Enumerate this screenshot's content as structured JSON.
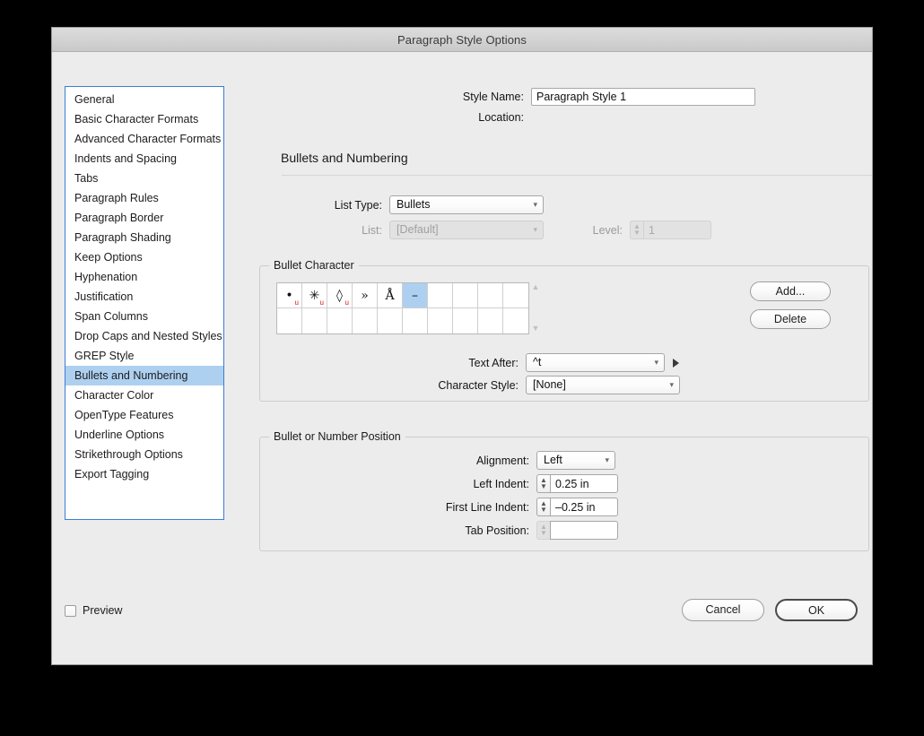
{
  "window": {
    "title": "Paragraph Style Options"
  },
  "sidebar": {
    "items": [
      {
        "label": "General",
        "selected": false
      },
      {
        "label": "Basic Character Formats",
        "selected": false
      },
      {
        "label": "Advanced Character Formats",
        "selected": false
      },
      {
        "label": "Indents and Spacing",
        "selected": false
      },
      {
        "label": "Tabs",
        "selected": false
      },
      {
        "label": "Paragraph Rules",
        "selected": false
      },
      {
        "label": "Paragraph Border",
        "selected": false
      },
      {
        "label": "Paragraph Shading",
        "selected": false
      },
      {
        "label": "Keep Options",
        "selected": false
      },
      {
        "label": "Hyphenation",
        "selected": false
      },
      {
        "label": "Justification",
        "selected": false
      },
      {
        "label": "Span Columns",
        "selected": false
      },
      {
        "label": "Drop Caps and Nested Styles",
        "selected": false
      },
      {
        "label": "GREP Style",
        "selected": false
      },
      {
        "label": "Bullets and Numbering",
        "selected": true
      },
      {
        "label": "Character Color",
        "selected": false
      },
      {
        "label": "OpenType Features",
        "selected": false
      },
      {
        "label": "Underline Options",
        "selected": false
      },
      {
        "label": "Strikethrough Options",
        "selected": false
      },
      {
        "label": "Export Tagging",
        "selected": false
      }
    ]
  },
  "header": {
    "style_name_label": "Style Name:",
    "style_name_value": "Paragraph Style 1",
    "location_label": "Location:",
    "location_value": ""
  },
  "section": {
    "title": "Bullets and Numbering"
  },
  "list_settings": {
    "list_type_label": "List Type:",
    "list_type_value": "Bullets",
    "list_label": "List:",
    "list_value": "[Default]",
    "level_label": "Level:",
    "level_value": "1"
  },
  "bullet_character": {
    "group_label": "Bullet Character",
    "cells": [
      {
        "glyph": "•",
        "unicode_marker": "u",
        "selected": false
      },
      {
        "glyph": "✳",
        "unicode_marker": "u",
        "selected": false
      },
      {
        "glyph": "◊",
        "unicode_marker": "u",
        "selected": false
      },
      {
        "glyph": "»",
        "unicode_marker": "",
        "selected": false
      },
      {
        "glyph": "Å",
        "unicode_marker": "",
        "selected": false
      },
      {
        "glyph": "–",
        "unicode_marker": "",
        "selected": true
      },
      {
        "glyph": "",
        "unicode_marker": "",
        "selected": false
      },
      {
        "glyph": "",
        "unicode_marker": "",
        "selected": false
      },
      {
        "glyph": "",
        "unicode_marker": "",
        "selected": false
      },
      {
        "glyph": "",
        "unicode_marker": "",
        "selected": false
      },
      {
        "glyph": "",
        "unicode_marker": "",
        "selected": false
      },
      {
        "glyph": "",
        "unicode_marker": "",
        "selected": false
      },
      {
        "glyph": "",
        "unicode_marker": "",
        "selected": false
      },
      {
        "glyph": "",
        "unicode_marker": "",
        "selected": false
      },
      {
        "glyph": "",
        "unicode_marker": "",
        "selected": false
      },
      {
        "glyph": "",
        "unicode_marker": "",
        "selected": false
      },
      {
        "glyph": "",
        "unicode_marker": "",
        "selected": false
      },
      {
        "glyph": "",
        "unicode_marker": "",
        "selected": false
      },
      {
        "glyph": "",
        "unicode_marker": "",
        "selected": false
      },
      {
        "glyph": "",
        "unicode_marker": "",
        "selected": false
      }
    ],
    "add_label": "Add...",
    "delete_label": "Delete",
    "text_after_label": "Text After:",
    "text_after_value": "^t",
    "character_style_label": "Character Style:",
    "character_style_value": "[None]"
  },
  "bullet_position": {
    "group_label": "Bullet or Number Position",
    "alignment_label": "Alignment:",
    "alignment_value": "Left",
    "left_indent_label": "Left Indent:",
    "left_indent_value": "0.25 in",
    "first_line_indent_label": "First Line Indent:",
    "first_line_indent_value": "–0.25 in",
    "tab_position_label": "Tab Position:",
    "tab_position_value": ""
  },
  "footer": {
    "preview_label": "Preview",
    "cancel_label": "Cancel",
    "ok_label": "OK"
  },
  "colors": {
    "selection_blue": "#aed0f0",
    "focus_border_blue": "#3b7dd8",
    "window_background": "#ececec",
    "unicode_marker_red": "#d21c1c"
  }
}
